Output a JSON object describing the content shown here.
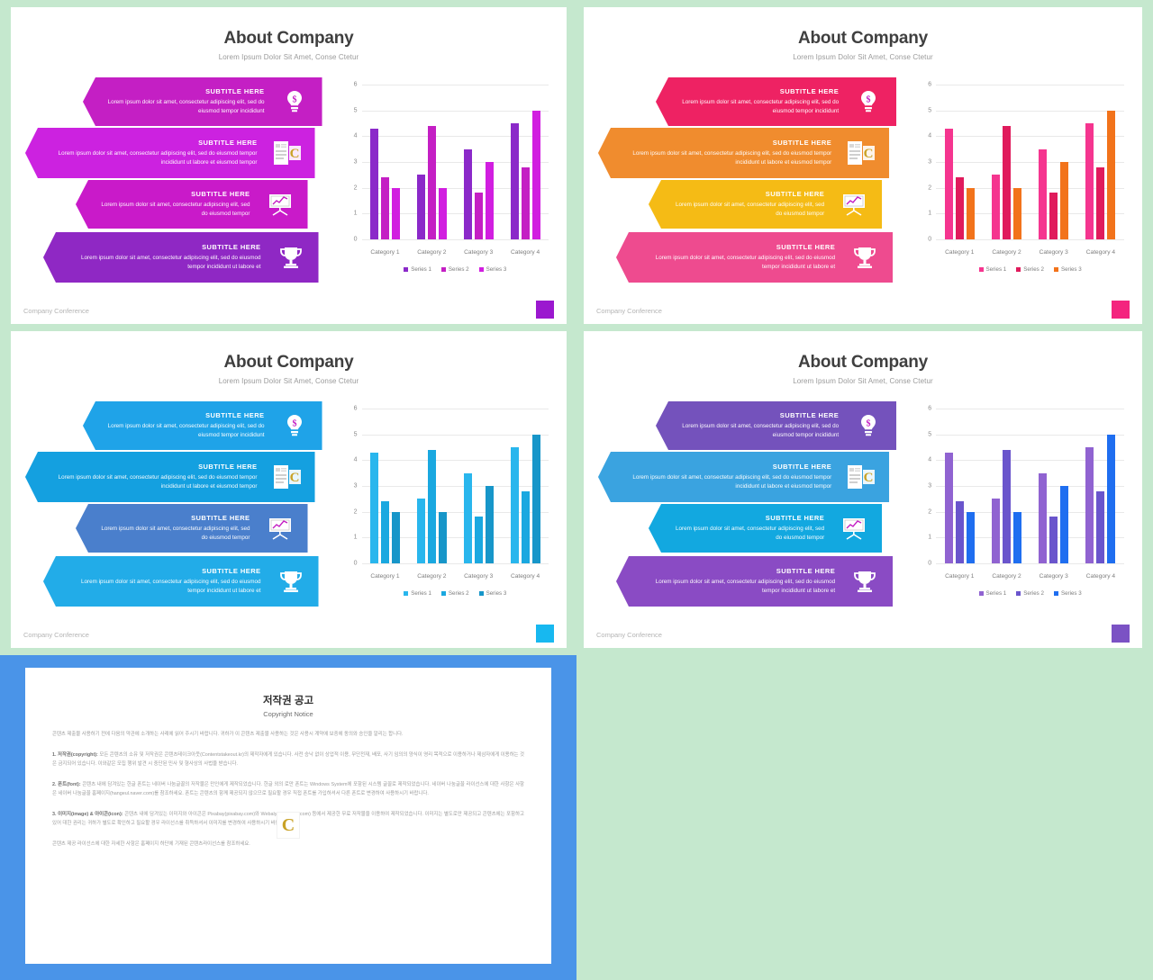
{
  "page": {
    "background_color": "#c5e8ce",
    "slide_bg": "#ffffff"
  },
  "slide_common": {
    "title": "About Company",
    "subtitle": "Lorem Ipsum Dolor Sit Amet, Conse Ctetur",
    "footer": "Company Conference",
    "banner_subtitle": "SUBTITLE HERE",
    "banner_descriptions": [
      "Lorem ipsum dolor sit amet, consectetur adipiscing elit, sed do eiusmod tempor incididunt",
      "Lorem ipsum dolor sit amet, consectetur adipiscing elit, sed do eiusmod tempor incididunt ut labore et eiusmod tempor",
      "Lorem ipsum dolor sit amet, consectetur adipiscing elit, sed do eiusmod tempor",
      "Lorem ipsum dolor sit amet, consectetur adipiscing elit, sed do eiusmod tempor incididunt ut labore et"
    ],
    "banner_icons": [
      "lightbulb-dollar-icon",
      "document-chart-icon",
      "presentation-chart-icon",
      "trophy-icon"
    ]
  },
  "slides": [
    {
      "id": "slide-purple-magenta",
      "banner_colors": [
        "#c41fc4",
        "#cc22e0",
        "#c91ac9",
        "#8f28c4"
      ],
      "badge_color": "#9b18cf",
      "chart_colors": [
        "#8b29c9",
        "#c41fc4",
        "#d11ee0"
      ]
    },
    {
      "id": "slide-pink-orange",
      "banner_colors": [
        "#ee2263",
        "#f08c2e",
        "#f5bb15",
        "#ee4b8f"
      ],
      "badge_color": "#f4247e",
      "chart_colors": [
        "#f5358f",
        "#e01b5c",
        "#f2731b"
      ]
    },
    {
      "id": "slide-blue",
      "banner_colors": [
        "#1fa3e8",
        "#14a0e0",
        "#4a7fcc",
        "#22ace8"
      ],
      "badge_color": "#17b8f0",
      "chart_colors": [
        "#29b6ed",
        "#1aa8e0",
        "#1796c9"
      ]
    },
    {
      "id": "slide-violet-blue",
      "banner_colors": [
        "#7452bc",
        "#3aa3e0",
        "#12a8e0",
        "#8a4bc4"
      ],
      "badge_color": "#7b52c4",
      "chart_colors": [
        "#9063d1",
        "#6a55cc",
        "#1f6ef0"
      ]
    }
  ],
  "chart_data": {
    "type": "bar",
    "title": "",
    "xlabel": "",
    "ylabel": "",
    "categories": [
      "Category 1",
      "Category 2",
      "Category 3",
      "Category 4"
    ],
    "series": [
      {
        "name": "Series 1",
        "values": [
          4.3,
          2.5,
          3.5,
          4.5
        ]
      },
      {
        "name": "Series 2",
        "values": [
          2.4,
          4.4,
          1.8,
          2.8
        ]
      },
      {
        "name": "Series 3",
        "values": [
          2.0,
          2.0,
          3.0,
          5.0
        ]
      }
    ],
    "ylim": [
      0,
      6
    ],
    "yticks": [
      0,
      1,
      2,
      3,
      4,
      5,
      6
    ],
    "grid": true,
    "legend_position": "bottom"
  },
  "copyright": {
    "panel_color": "#4a94e8",
    "title": "저작권 공고",
    "subtitle": "Copyright Notice",
    "watermark_letter": "C",
    "intro": "콘텐츠 제출물 사용하기 전에 다음의 약관에 소개하는 사례에 읽어 주시기 바랍니다. 귀하가 이 콘텐츠 제출물 사용하는 것은 사용시 계약에 보증에 동의와 승인을 알리는 합니다.",
    "paragraphs": [
      {
        "heading": "1. 저작권(copyright):",
        "body": "모든 콘텐츠의 소유 및 저작권은 콘텐츠테이크아웃(Contentstakeout.kr)의 제작자에게 있습니다. 사전 승낙 없이 상업적 이용, 무단전재, 배포, 사기 임의의 양식이 영리 목적으로 이용하거나 제삼자에게 이용하는 것은 금지되어 있습니다. 이와같은 모집 행위 발견 시 중단된 민사 및 형사상의 사법을 받습니다."
      },
      {
        "heading": "2. 폰트(font):",
        "body": "콘텐츠 내에 담겨있는 한글 폰트는 네이버 나눔글꼴의 저작물은 만인에게 제작되었습니다. 한글 외의 로만 폰트는 Windows System에 포함된 시스템 글꼴로 제작되었습니다. 네이버 나눔글꼴 라이선스에 대한 사항은 사항은 네이버 나눔글꼴 홈페이지(hangeul.naver.com)를 참조하세요. 폰트는 콘텐츠의 함께 제공되지 않으므로 필요할 경우 직접 폰트를 가입하셔서 다른 폰트로 변경하여 사용하시기 바랍니다."
      },
      {
        "heading": "3. 이미지(image) & 아이콘(icon):",
        "body": "콘텐츠 내에 담겨있는 이미지와 아이콘은 Pixabay(pixabay.com)와 Webalys(webalys.com) 등에서 제공한 무료 저작물을 이용하여 제작되었습니다. 이미지는 별도로만 제공되고 콘텐츠에는 포함하고 있어 대한 권리는 귀하가 별도로 확인하고 필요할 경우 라이선스를 취득하셔서 이미지를 변경하여 사용하시기 바랍니다."
      }
    ],
    "closing": "콘텐츠 제공 라이선스에 대한 자세한 사항은 홈페이지 하단에 기재된 콘텐츠라이선스를 참조하세요."
  }
}
